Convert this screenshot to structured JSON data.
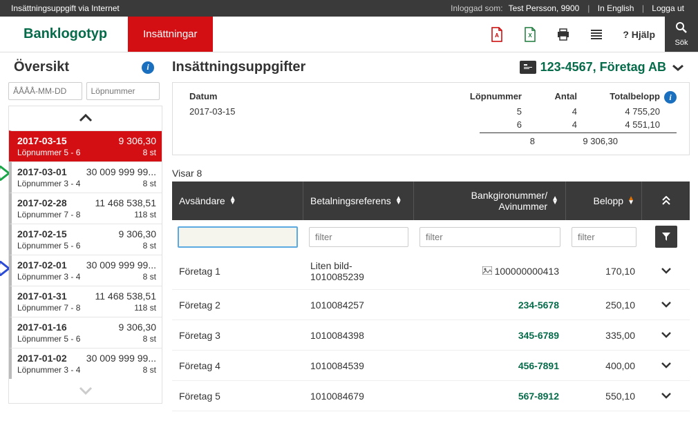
{
  "topbar": {
    "title": "Insättningsuppgift via Internet",
    "logged_label": "Inloggad som:",
    "user": "Test Persson, 9900",
    "english": "In English",
    "logout": "Logga ut"
  },
  "nav": {
    "logo": "Banklogotyp",
    "active": "Insättningar",
    "help_q": "?",
    "help": "Hjälp",
    "search": "Sök"
  },
  "sidebar": {
    "title": "Översikt",
    "date_placeholder": "ÅÅÅÅ-MM-DD",
    "seq_placeholder": "Löpnummer",
    "items": [
      {
        "date": "2017-03-15",
        "amount": "9 306,30",
        "lop": "Löpnummer 5 - 6",
        "count": "8 st"
      },
      {
        "date": "2017-03-01",
        "amount": "30 009 999 99...",
        "lop": "Löpnummer 3 - 4",
        "count": "8 st"
      },
      {
        "date": "2017-02-28",
        "amount": "11 468 538,51",
        "lop": "Löpnummer 7 - 8",
        "count": "118 st"
      },
      {
        "date": "2017-02-15",
        "amount": "9 306,30",
        "lop": "Löpnummer 5 - 6",
        "count": "8 st"
      },
      {
        "date": "2017-02-01",
        "amount": "30 009 999 99...",
        "lop": "Löpnummer 3 - 4",
        "count": "8 st"
      },
      {
        "date": "2017-01-31",
        "amount": "11 468 538,51",
        "lop": "Löpnummer 7 - 8",
        "count": "118 st"
      },
      {
        "date": "2017-01-16",
        "amount": "9 306,30",
        "lop": "Löpnummer 5 - 6",
        "count": "8 st"
      },
      {
        "date": "2017-01-02",
        "amount": "30 009 999 99...",
        "lop": "Löpnummer 3 - 4",
        "count": "8 st"
      }
    ]
  },
  "content": {
    "title": "Insättningsuppgifter",
    "account": "123-4567, Företag AB",
    "summary": {
      "headers": {
        "date": "Datum",
        "seq": "Löpnummer",
        "count": "Antal",
        "total": "Totalbelopp"
      },
      "date": "2017-03-15",
      "rows": [
        {
          "seq": "5",
          "count": "4",
          "total": "4 755,20"
        },
        {
          "seq": "6",
          "count": "4",
          "total": "4 551,10"
        }
      ],
      "total": {
        "count": "8",
        "total": "9 306,30"
      }
    },
    "showing": "Visar 8",
    "grid_headers": {
      "sender": "Avsändare",
      "ref": "Betalningsreferens",
      "bank": "Bankgironummer/ Avinummer",
      "amount": "Belopp"
    },
    "filter_placeholder": "filter",
    "rows": [
      {
        "sender": "Företag 1",
        "ref": "Liten bild- 1010085239",
        "bank": "100000000413",
        "bank_is_link": false,
        "has_image": true,
        "amount": "170,10"
      },
      {
        "sender": "Företag 2",
        "ref": "1010084257",
        "bank": "234-5678",
        "bank_is_link": true,
        "amount": "250,10"
      },
      {
        "sender": "Företag 3",
        "ref": "1010084398",
        "bank": "345-6789",
        "bank_is_link": true,
        "amount": "335,00"
      },
      {
        "sender": "Företag 4",
        "ref": "1010084539",
        "bank": "456-7891",
        "bank_is_link": true,
        "amount": "400,00"
      },
      {
        "sender": "Företag 5",
        "ref": "1010084679",
        "bank": "567-8912",
        "bank_is_link": true,
        "amount": "550,10"
      }
    ]
  }
}
